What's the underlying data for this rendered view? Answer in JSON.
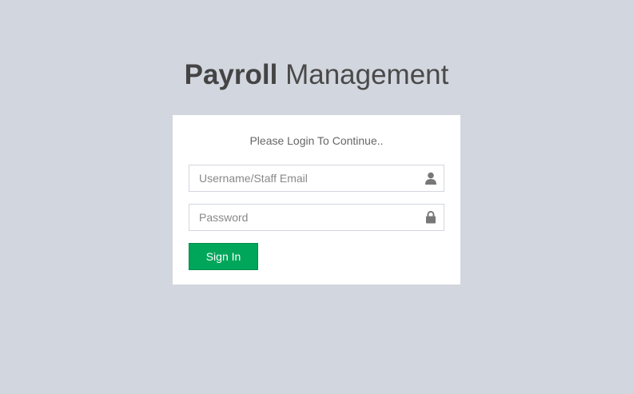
{
  "logo": {
    "bold": "Payroll",
    "light": "Management"
  },
  "login": {
    "message": "Please Login To Continue..",
    "username_placeholder": "Username/Staff Email",
    "username_value": "",
    "password_placeholder": "Password",
    "password_value": "",
    "signin_label": "Sign In"
  },
  "icons": {
    "username": "user-icon",
    "password": "lock-icon"
  },
  "colors": {
    "background": "#d2d6de",
    "box": "#ffffff",
    "signin_button": "#00a65a",
    "icon": "#777777"
  }
}
